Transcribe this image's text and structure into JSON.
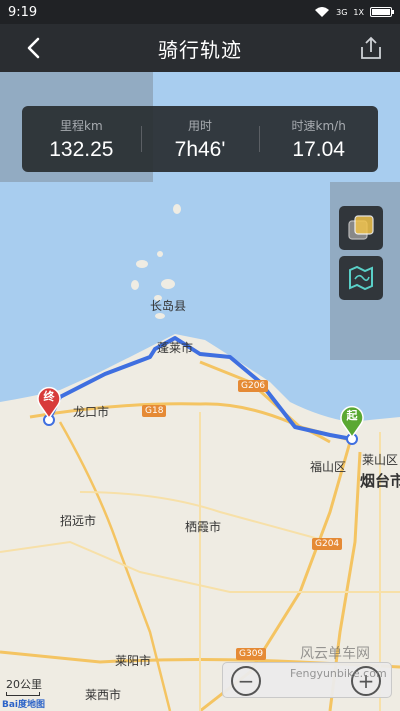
{
  "status_bar": {
    "time": "9:19",
    "network_labels": [
      "3G",
      "1X"
    ],
    "battery_percent": 100
  },
  "header": {
    "title": "骑行轨迹",
    "back_icon": "chevron-left-icon",
    "share_icon": "share-icon"
  },
  "stats": [
    {
      "label": "里程km",
      "value": "132.25"
    },
    {
      "label": "用时",
      "value": "7h46'"
    },
    {
      "label": "时速km/h",
      "value": "17.04"
    }
  ],
  "map": {
    "place_labels": {
      "changdao": "长岛县",
      "penglai": "蓬莱市",
      "longkou": "龙口市",
      "fushan": "福山区",
      "laishan": "莱山区",
      "yantai": "烟台市",
      "zhaoyuan": "招远市",
      "qixia": "栖霞市",
      "laiyang": "莱阳市",
      "laixi": "莱西市"
    },
    "roads": {
      "g18": "G18",
      "g206": "G206",
      "g204": "G204",
      "g309": "G309"
    },
    "start_marker": "起",
    "end_marker": "终",
    "route_color": "#3f6fe0",
    "scale_label": "20公里",
    "logo_text": "Bai度地图",
    "watermark_main": "风云单车网",
    "watermark_url": "Fengyunbike.com",
    "tools": [
      "layers-icon",
      "map-view-icon"
    ],
    "zoom_out_symbol": "−",
    "zoom_in_symbol": "+"
  }
}
